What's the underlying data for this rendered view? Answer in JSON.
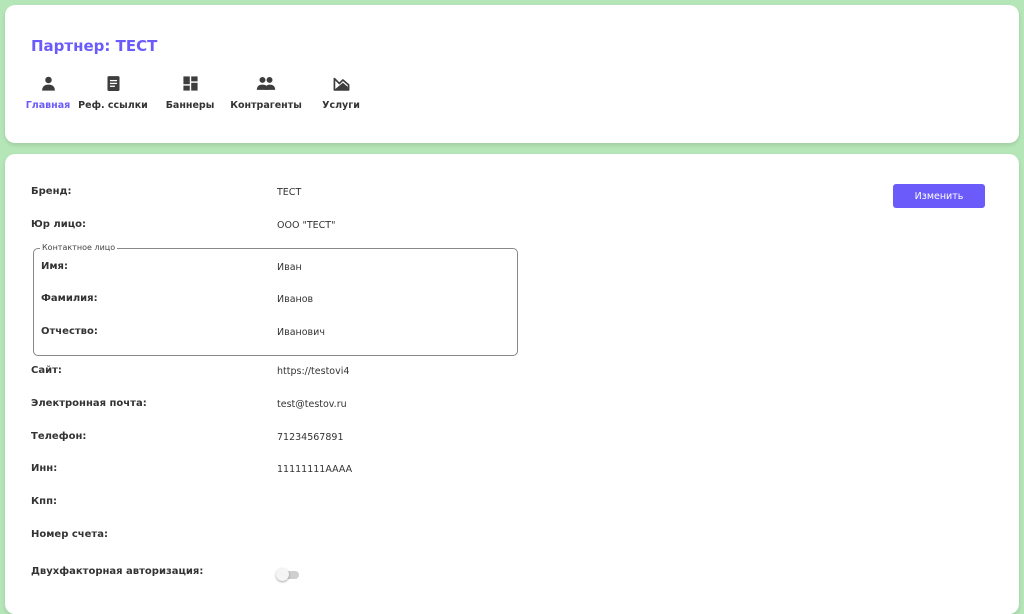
{
  "header": {
    "title": "Партнер: ТЕСТ",
    "nav": [
      {
        "label": "Главная",
        "icon": "user-icon",
        "active": true
      },
      {
        "label": "Реф. ссылки",
        "icon": "document-icon",
        "active": false
      },
      {
        "label": "Баннеры",
        "icon": "dashboard-icon",
        "active": false
      },
      {
        "label": "Контрагенты",
        "icon": "people-icon",
        "active": false
      },
      {
        "label": "Услуги",
        "icon": "landscape-icon",
        "active": false
      }
    ]
  },
  "colors": {
    "accent": "#6b5bfa",
    "background": "#b5e6b8"
  },
  "profile": {
    "edit_button": "Изменить",
    "brand": {
      "label": "Бренд:",
      "value": "ТЕСТ"
    },
    "legal_entity": {
      "label": "Юр лицо:",
      "value": "ООО \"ТЕСТ\""
    },
    "contact": {
      "legend": "Контактное лицо",
      "first_name": {
        "label": "Имя:",
        "value": "Иван"
      },
      "last_name": {
        "label": "Фамилия:",
        "value": "Иванов"
      },
      "patronymic": {
        "label": "Отчество:",
        "value": "Иванович"
      }
    },
    "site": {
      "label": "Сайт:",
      "value": "https://testovi4"
    },
    "email": {
      "label": "Электронная почта:",
      "value": "test@testov.ru"
    },
    "phone": {
      "label": "Телефон:",
      "value": "71234567891"
    },
    "inn": {
      "label": "Инн:",
      "value": "11111111AAAA"
    },
    "kpp": {
      "label": "Кпп:",
      "value": ""
    },
    "account": {
      "label": "Номер счета:",
      "value": ""
    },
    "two_factor": {
      "label": "Двухфакторная авторизация:",
      "enabled": false
    }
  }
}
